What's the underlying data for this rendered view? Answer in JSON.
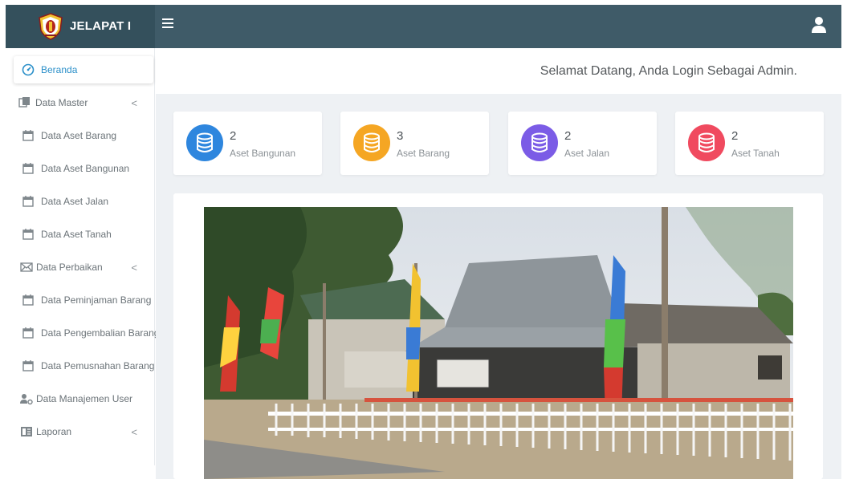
{
  "app": {
    "title": "JELAPAT I"
  },
  "header": {
    "menu_icon": "hamburger-icon",
    "user_icon": "user-icon"
  },
  "welcome": {
    "text": "Selamat Datang, Anda Login Sebagai Admin."
  },
  "sidebar": {
    "items": [
      {
        "label": "Beranda",
        "icon": "dashboard-icon",
        "active": true
      },
      {
        "label": "Data Master",
        "icon": "copy-icon",
        "has_submenu": true
      },
      {
        "label": "Data Aset Barang",
        "icon": "calendar-icon"
      },
      {
        "label": "Data Aset Bangunan",
        "icon": "calendar-icon"
      },
      {
        "label": "Data Aset Jalan",
        "icon": "calendar-icon"
      },
      {
        "label": "Data Aset Tanah",
        "icon": "calendar-icon"
      },
      {
        "label": "Data Perbaikan",
        "icon": "envelope-icon",
        "has_submenu": true
      },
      {
        "label": "Data Peminjaman Barang",
        "icon": "calendar-icon"
      },
      {
        "label": "Data Pengembalian Barang",
        "icon": "calendar-icon"
      },
      {
        "label": "Data Pemusnahan Barang",
        "icon": "calendar-icon"
      },
      {
        "label": "Data Manajemen User",
        "icon": "users-cog-icon"
      },
      {
        "label": "Laporan",
        "icon": "report-icon",
        "has_submenu": true
      }
    ],
    "chevron": "<"
  },
  "stats": [
    {
      "count": "2",
      "label": "Aset Bangunan",
      "color": "#2e86de"
    },
    {
      "count": "3",
      "label": "Aset Barang",
      "color": "#f5a623"
    },
    {
      "count": "2",
      "label": "Aset Jalan",
      "color": "#7b5ce6"
    },
    {
      "count": "2",
      "label": "Aset Tanah",
      "color": "#f04a5f"
    }
  ],
  "colors": {
    "topbar": "#3f5b68",
    "brand": "#34505c",
    "accent": "#2a8fc9",
    "background": "#eef1f4"
  }
}
